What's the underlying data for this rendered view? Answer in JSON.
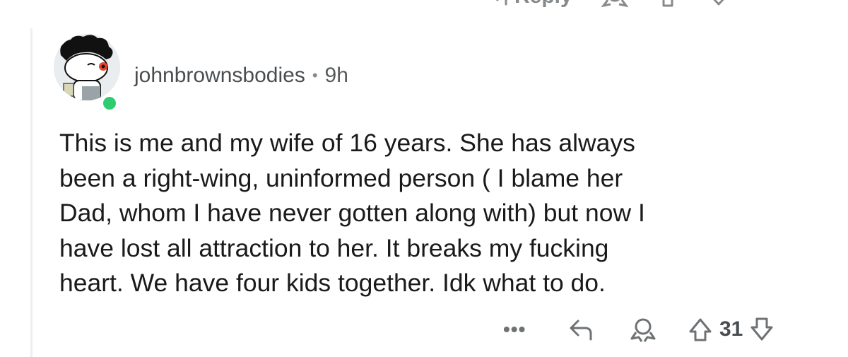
{
  "parent_actions": {
    "reply_label": "Reply",
    "icons": [
      "reply-arrow-icon",
      "award-icon",
      "upvote-icon",
      "downvote-icon"
    ]
  },
  "comment": {
    "username": "johnbrownsbodies",
    "separator": "•",
    "time_ago": "9h",
    "online": true,
    "online_color": "#2ecc71",
    "body": "This is me and my wife of 16 years. She has always\nbeen a right-wing, uninformed person ( I blame her\nDad, whom I have never gotten along with) but now I\nhave lost all attraction to her. It breaks my fucking\nheart. We have four kids together.  Idk what to do.",
    "actions": {
      "more_label": "•••",
      "score": "31"
    }
  }
}
